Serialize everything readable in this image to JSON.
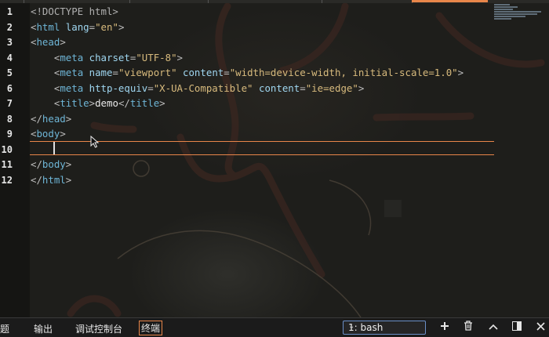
{
  "editor": {
    "lines": [
      {
        "n": "1",
        "tokens": [
          [
            "t-doc",
            "<!DOCTYPE html>"
          ]
        ]
      },
      {
        "n": "2",
        "tokens": [
          [
            "t-punct",
            "<"
          ],
          [
            "t-tag",
            "html"
          ],
          [
            "t-punct",
            " "
          ],
          [
            "t-attr",
            "lang"
          ],
          [
            "t-punct",
            "="
          ],
          [
            "t-str",
            "\"en\""
          ],
          [
            "t-punct",
            ">"
          ]
        ]
      },
      {
        "n": "3",
        "tokens": [
          [
            "t-punct",
            "<"
          ],
          [
            "t-tag",
            "head"
          ],
          [
            "t-punct",
            ">"
          ]
        ]
      },
      {
        "n": "4",
        "tokens": [
          [
            "t-punct",
            "    <"
          ],
          [
            "t-tag",
            "meta"
          ],
          [
            "t-punct",
            " "
          ],
          [
            "t-attr",
            "charset"
          ],
          [
            "t-punct",
            "="
          ],
          [
            "t-str",
            "\"UTF-8\""
          ],
          [
            "t-punct",
            ">"
          ]
        ]
      },
      {
        "n": "5",
        "tokens": [
          [
            "t-punct",
            "    <"
          ],
          [
            "t-tag",
            "meta"
          ],
          [
            "t-punct",
            " "
          ],
          [
            "t-attr",
            "name"
          ],
          [
            "t-punct",
            "="
          ],
          [
            "t-str",
            "\"viewport\""
          ],
          [
            "t-punct",
            " "
          ],
          [
            "t-attr",
            "content"
          ],
          [
            "t-punct",
            "="
          ],
          [
            "t-str",
            "\"width=device-width, initial-scale=1.0\""
          ],
          [
            "t-punct",
            ">"
          ]
        ]
      },
      {
        "n": "6",
        "tokens": [
          [
            "t-punct",
            "    <"
          ],
          [
            "t-tag",
            "meta"
          ],
          [
            "t-punct",
            " "
          ],
          [
            "t-attr",
            "http-equiv"
          ],
          [
            "t-punct",
            "="
          ],
          [
            "t-str",
            "\"X-UA-Compatible\""
          ],
          [
            "t-punct",
            " "
          ],
          [
            "t-attr",
            "content"
          ],
          [
            "t-punct",
            "="
          ],
          [
            "t-str",
            "\"ie=edge\""
          ],
          [
            "t-punct",
            ">"
          ]
        ]
      },
      {
        "n": "7",
        "tokens": [
          [
            "t-punct",
            "    <"
          ],
          [
            "t-tag",
            "title"
          ],
          [
            "t-punct",
            ">"
          ],
          [
            "t-txt",
            "demo"
          ],
          [
            "t-punct",
            "</"
          ],
          [
            "t-tag",
            "title"
          ],
          [
            "t-punct",
            ">"
          ]
        ]
      },
      {
        "n": "8",
        "tokens": [
          [
            "t-punct",
            "</"
          ],
          [
            "t-tag",
            "head"
          ],
          [
            "t-punct",
            ">"
          ]
        ]
      },
      {
        "n": "9",
        "tokens": [
          [
            "t-punct",
            "<"
          ],
          [
            "t-tag",
            "body"
          ],
          [
            "t-punct",
            ">"
          ]
        ]
      },
      {
        "n": "10",
        "tokens": []
      },
      {
        "n": "11",
        "tokens": [
          [
            "t-punct",
            "</"
          ],
          [
            "t-tag",
            "body"
          ],
          [
            "t-punct",
            ">"
          ]
        ]
      },
      {
        "n": "12",
        "tokens": [
          [
            "t-punct",
            "</"
          ],
          [
            "t-tag",
            "html"
          ],
          [
            "t-punct",
            ">"
          ]
        ]
      }
    ],
    "active_line": "10"
  },
  "panel": {
    "tabs": [
      "题",
      "输出",
      "调试控制台",
      "终端"
    ],
    "active_tab": "终端",
    "terminal_select": "1: bash",
    "icons": [
      "add-icon",
      "trash-icon",
      "chevron-up-icon",
      "split-icon",
      "close-icon"
    ]
  },
  "colors": {
    "accent": "#e8864a",
    "tag": "#6eb5d6",
    "attr": "#9fd6f0",
    "string": "#d7ba7d"
  }
}
